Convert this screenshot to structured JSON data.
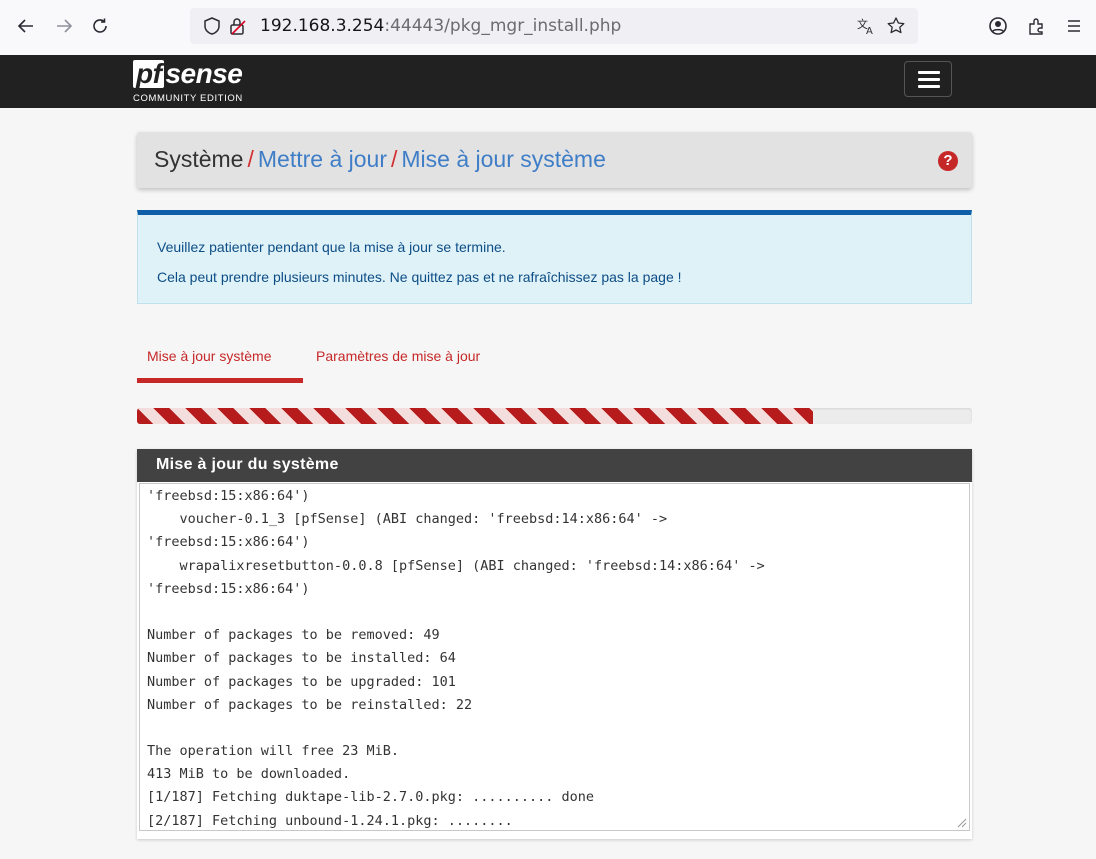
{
  "browser": {
    "back_icon": "arrow-left-icon",
    "forward_icon": "arrow-right-icon",
    "reload_icon": "reload-icon",
    "url_host": "192.168.3.254",
    "url_rest": ":44443/pkg_mgr_install.php",
    "icons": [
      "shield-icon",
      "lock-icon",
      "translate-icon",
      "star-icon",
      "account-icon",
      "extensions-icon",
      "menu-icon"
    ]
  },
  "navbar": {
    "logo_pf": "pf",
    "logo_sense": "sense",
    "logo_edition": "COMMUNITY EDITION"
  },
  "breadcrumb": {
    "root": "Système",
    "sep1": "/",
    "link1": "Mettre à jour",
    "sep2": "/",
    "link2": "Mise à jour système",
    "help_glyph": "?"
  },
  "alert": {
    "line1": "Veuillez patienter pendant que la mise à jour se termine.",
    "line2": "Cela peut prendre plusieurs minutes. Ne quittez pas et ne rafraîchissez pas la page !"
  },
  "tabs": [
    {
      "label": "Mise à jour système",
      "active": true
    },
    {
      "label": "Paramètres de mise à jour",
      "active": false
    }
  ],
  "progress": {
    "fraction": 0.81,
    "color": "#b71c1c"
  },
  "panel": {
    "title": "Mise à jour du système",
    "log": [
      "'freebsd:15:x86:64')",
      "    voucher-0.1_3 [pfSense] (ABI changed: 'freebsd:14:x86:64' ->",
      "'freebsd:15:x86:64')",
      "    wrapalixresetbutton-0.0.8 [pfSense] (ABI changed: 'freebsd:14:x86:64' ->",
      "'freebsd:15:x86:64')",
      "",
      "Number of packages to be removed: 49",
      "Number of packages to be installed: 64",
      "Number of packages to be upgraded: 101",
      "Number of packages to be reinstalled: 22",
      "",
      "The operation will free 23 MiB.",
      "413 MiB to be downloaded.",
      "[1/187] Fetching duktape-lib-2.7.0.pkg: .......... done",
      "[2/187] Fetching unbound-1.24.1.pkg: ........"
    ]
  },
  "colors": {
    "navbar": "#212121",
    "accent_red": "#c62828",
    "link_blue": "#3f7ec7",
    "alert_bg": "#dff2f8",
    "alert_border": "#0e5fa8",
    "panel_heading": "#424242"
  }
}
